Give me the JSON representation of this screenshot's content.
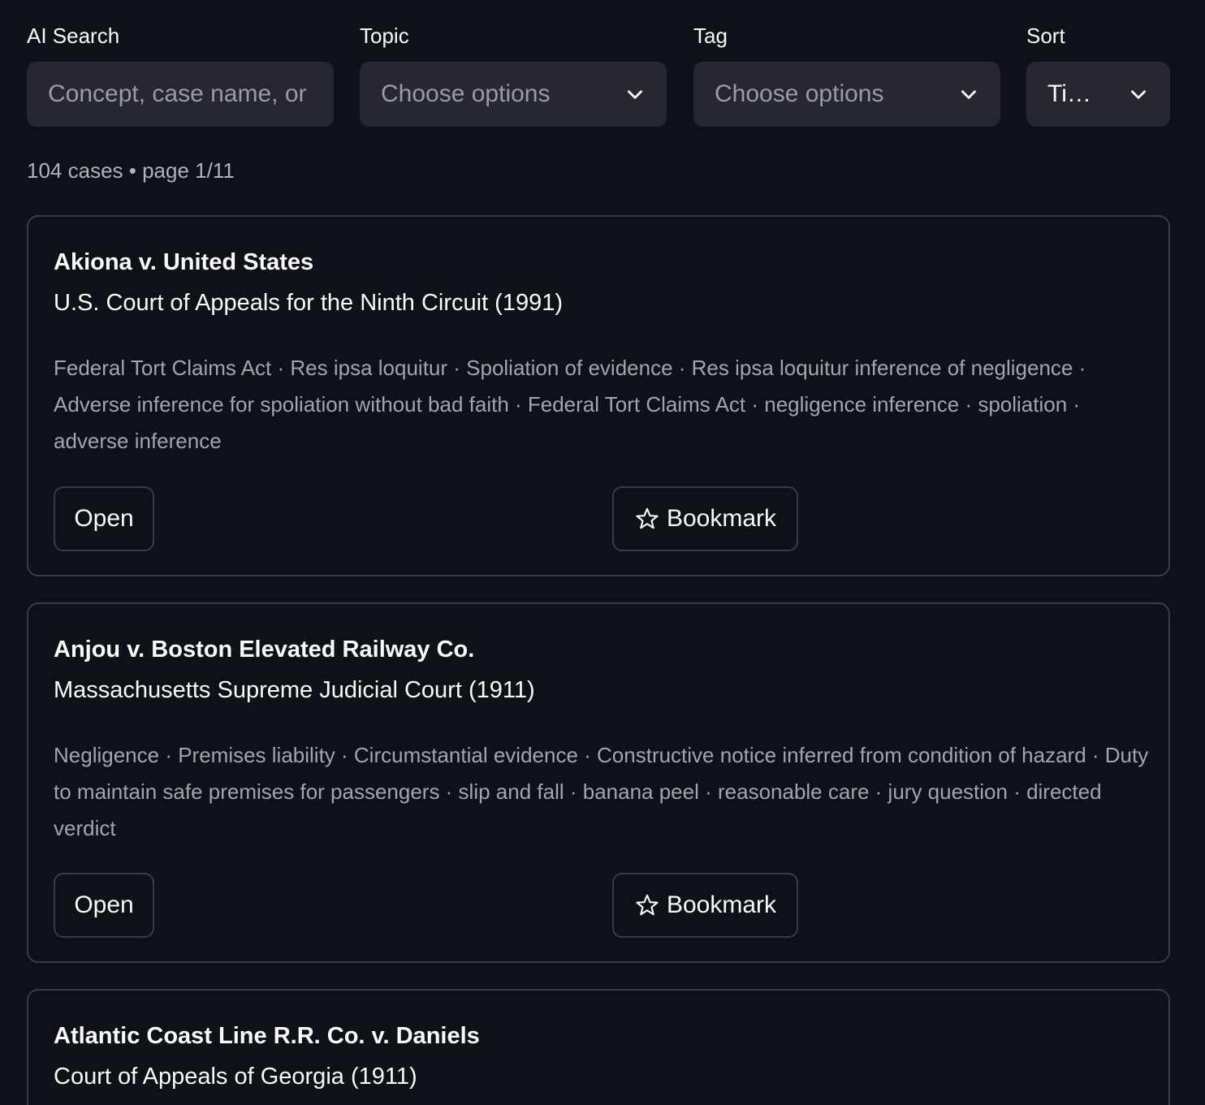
{
  "filters": {
    "search": {
      "label": "AI Search",
      "placeholder": "Concept, case name, or rule"
    },
    "topic": {
      "label": "Topic",
      "placeholder": "Choose options"
    },
    "tag": {
      "label": "Tag",
      "placeholder": "Choose options"
    },
    "sort": {
      "label": "Sort",
      "value": "Ti…"
    }
  },
  "results": {
    "summary": "104 cases • page 1/11"
  },
  "cases": [
    {
      "title": "Akiona v. United States",
      "court": "U.S. Court of Appeals for the Ninth Circuit (1991)",
      "tags": "Federal Tort Claims Act · Res ipsa loquitur · Spoliation of evidence · Res ipsa loquitur inference of negligence · Adverse inference for spoliation without bad faith · Federal Tort Claims Act · negligence inference · spoliation · adverse inference",
      "open_label": "Open",
      "bookmark_label": "Bookmark"
    },
    {
      "title": "Anjou v. Boston Elevated Railway Co.",
      "court": "Massachusetts Supreme Judicial Court (1911)",
      "tags": "Negligence · Premises liability · Circumstantial evidence · Constructive notice inferred from condition of hazard · Duty to maintain safe premises for passengers · slip and fall · banana peel · reasonable care · jury question · directed verdict",
      "open_label": "Open",
      "bookmark_label": "Bookmark"
    },
    {
      "title": "Atlantic Coast Line R.R. Co. v. Daniels",
      "court": "Court of Appeals of Georgia (1911)"
    }
  ],
  "icons": {
    "dropdown": "chevron-down-icon",
    "bookmark": "star-outline-icon"
  },
  "colors": {
    "background": "#0e1117",
    "input_background": "#262730",
    "border": "#3a3d46",
    "text": "#fafafa",
    "muted_text": "#a3a5ab"
  }
}
